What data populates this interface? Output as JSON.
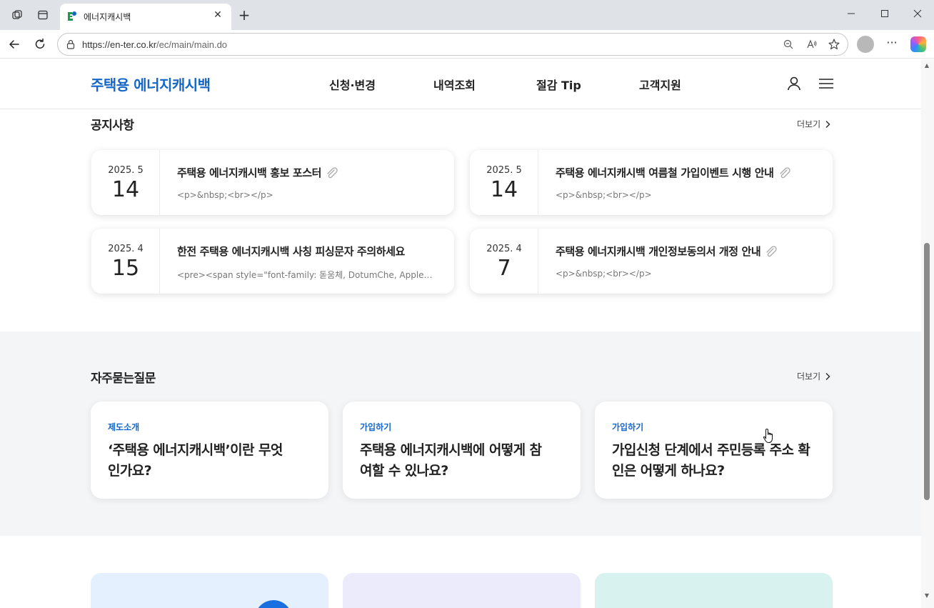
{
  "browser": {
    "tab_title": "에너지캐시백",
    "url_host": "https://en-ter.co.kr",
    "url_path": "/ec/main/main.do",
    "icons": [
      "workspaces-icon",
      "tab-actions-icon",
      "favicon-icon",
      "close-tab-icon",
      "new-tab-icon",
      "minimize-icon",
      "maximize-icon",
      "close-window-icon",
      "back-icon",
      "refresh-icon",
      "lock-icon",
      "zoom-out-icon",
      "read-aloud-icon",
      "favorite-star-icon",
      "profile-icon",
      "more-icon",
      "copilot-icon"
    ]
  },
  "header": {
    "logo": "주택용 에너지캐시백",
    "nav": [
      "신청·변경",
      "내역조회",
      "절감 Tip",
      "고객지원"
    ],
    "icons": [
      "user-icon",
      "menu-icon"
    ]
  },
  "notices": {
    "title": "공지사항",
    "more": "더보기",
    "items": [
      {
        "ym": "2025. 5",
        "day": "14",
        "title": "주택용 에너지캐시백 홍보 포스터",
        "excerpt": "<p>&nbsp;<br></p>",
        "attachment": true
      },
      {
        "ym": "2025. 5",
        "day": "14",
        "title": "주택용 에너지캐시백 여름철 가입이벤트 시행 안내",
        "excerpt": "<p>&nbsp;<br></p>",
        "attachment": true
      },
      {
        "ym": "2025. 4",
        "day": "15",
        "title": "한전 주택용 에너지캐시백 사칭 피싱문자 주의하세요",
        "excerpt": "<pre><span style=\"font-family: 돋움체, DotumChe, AppleGothic; f...",
        "attachment": false
      },
      {
        "ym": "2025. 4",
        "day": "7",
        "title": "주택용 에너지캐시백 개인정보동의서 개정 안내",
        "excerpt": "<p>&nbsp;<br></p>",
        "attachment": true
      }
    ]
  },
  "faq": {
    "title": "자주묻는질문",
    "more": "더보기",
    "items": [
      {
        "category": "제도소개",
        "question": "‘주택용 에너지캐시백’이란 무엇인가요?"
      },
      {
        "category": "가입하기",
        "question": "주택용 에너지캐시백에 어떻게 참여할 수 있나요?"
      },
      {
        "category": "가입하기",
        "question": "가입신청 단계에서 주민등록 주소 확인은 어떻게 하나요?"
      }
    ]
  },
  "colors": {
    "brand_blue": "#1466c8",
    "faq_band": "#f4f5f7",
    "promo_1": "#e4f0fd",
    "promo_2": "#ecebfb",
    "promo_3": "#d8f3ef"
  }
}
